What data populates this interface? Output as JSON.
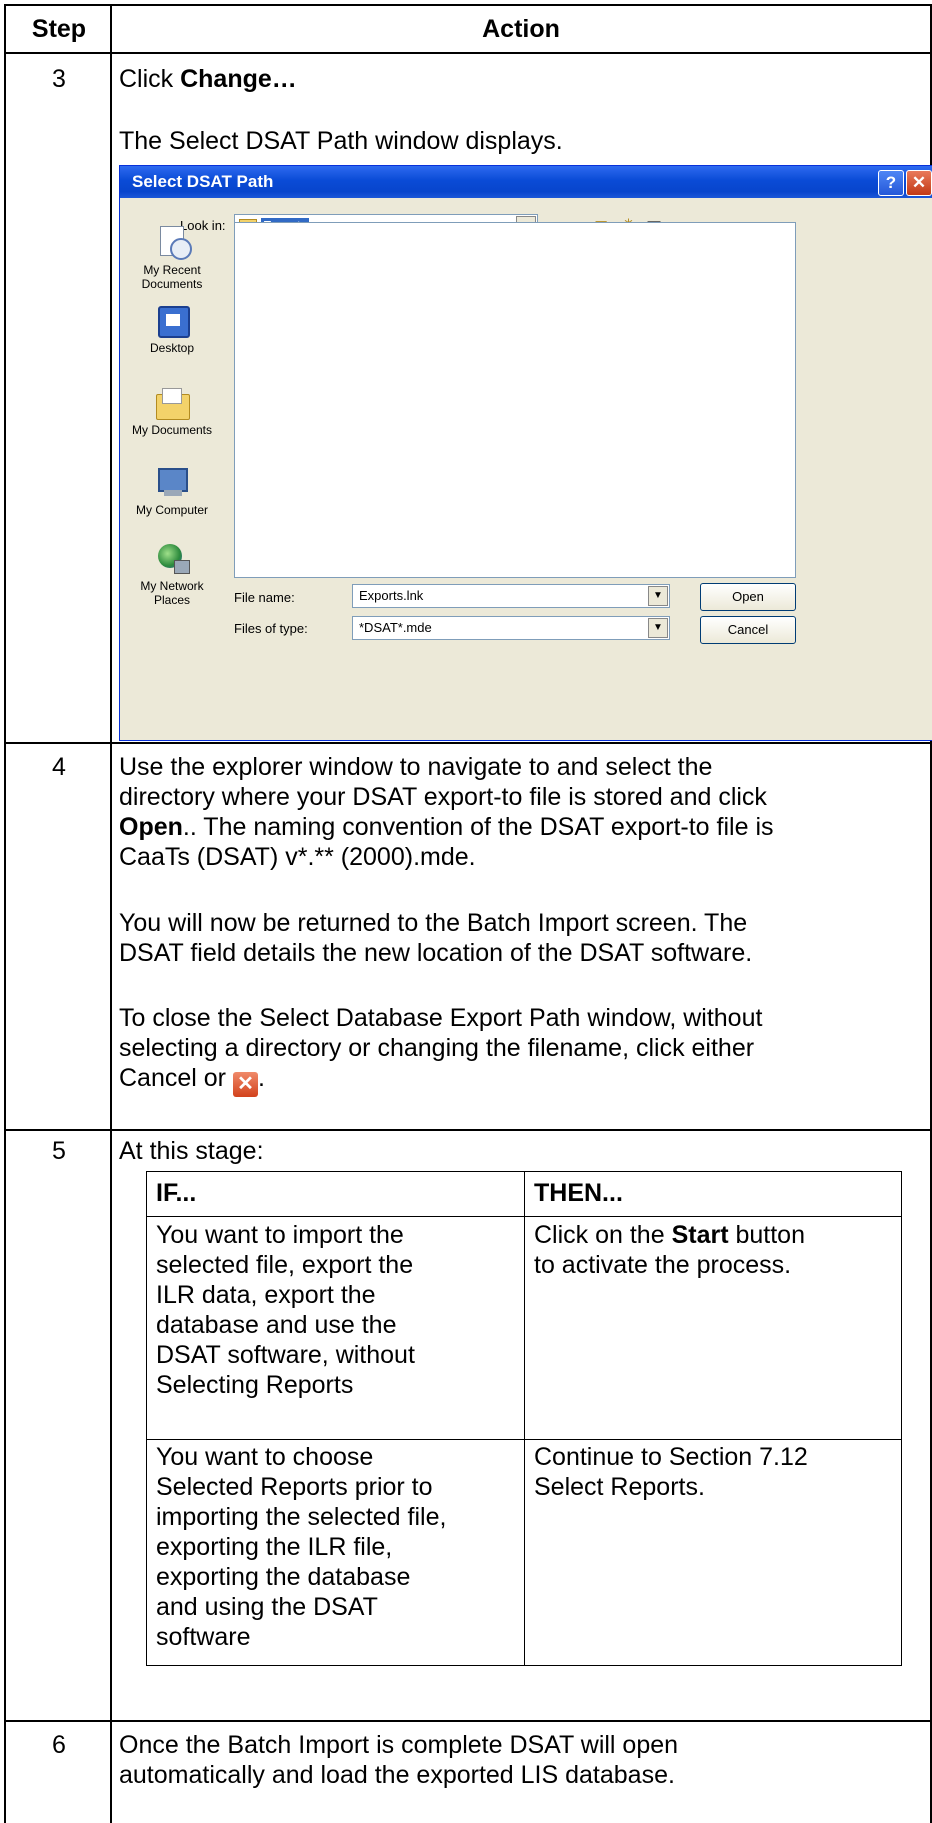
{
  "header": {
    "step": "Step",
    "action": "Action"
  },
  "step3": {
    "number": "3",
    "line1_prefix": "Click ",
    "line1_bold": "Change…",
    "line2": "The Select DSAT Path window displays."
  },
  "dialog": {
    "title": "Select DSAT Path",
    "help_glyph": "?",
    "close_glyph": "✕",
    "look_in_label": "Look in:",
    "look_in_value": "Exports",
    "places": [
      {
        "label": "My Recent Documents",
        "icon": "recent-documents-icon"
      },
      {
        "label": "Desktop",
        "icon": "desktop-icon"
      },
      {
        "label": "My Documents",
        "icon": "my-documents-icon"
      },
      {
        "label": "My Computer",
        "icon": "my-computer-icon"
      },
      {
        "label": "My Network Places",
        "icon": "network-places-icon"
      }
    ],
    "file_name_label": "File name:",
    "file_name_value": "Exports.lnk",
    "files_of_type_label": "Files of type:",
    "files_of_type_value": "*DSAT*.mde",
    "open_button": "Open",
    "cancel_button": "Cancel"
  },
  "step4": {
    "number": "4",
    "p1_lines": [
      "Use the explorer window to navigate to and select the",
      "directory where your DSAT export-to file is stored and click"
    ],
    "p1_bold": "Open",
    "p1_after_bold": "..  The naming convention of the DSAT export-to file is",
    "p1_last": "CaaTs (DSAT) v*.** (2000).mde.",
    "p2_lines": [
      "You will now be returned to the Batch Import screen. The",
      "DSAT field details the new location of the DSAT software."
    ],
    "p3_lines": [
      "To close the Select Database Export Path window, without",
      "selecting a directory or changing the filename, click either"
    ],
    "p3_last": "Cancel or ",
    "p3_period": "."
  },
  "step5": {
    "number": "5",
    "intro": "At this stage:",
    "table": {
      "col1": "IF...",
      "col2": "THEN...",
      "rows": [
        {
          "if_lines": [
            "You want to import the",
            "selected file, export the",
            "ILR data, export the",
            "database and use the",
            "DSAT software, without",
            "Selecting Reports"
          ],
          "then_prefix": "Click on the ",
          "then_bold": "Start",
          "then_suffix": " button",
          "then_line2": "to activate the process."
        },
        {
          "if_lines": [
            "You want to choose",
            "Selected Reports prior to",
            "importing the selected file,",
            "exporting the ILR file,",
            "exporting the database",
            "and using the DSAT",
            "software"
          ],
          "then_lines": [
            "Continue to Section 7.12",
            "Select Reports."
          ]
        }
      ]
    }
  },
  "step6": {
    "number": "6",
    "lines": [
      "Once the Batch Import is complete DSAT will open",
      "automatically and load the exported LIS database."
    ]
  }
}
